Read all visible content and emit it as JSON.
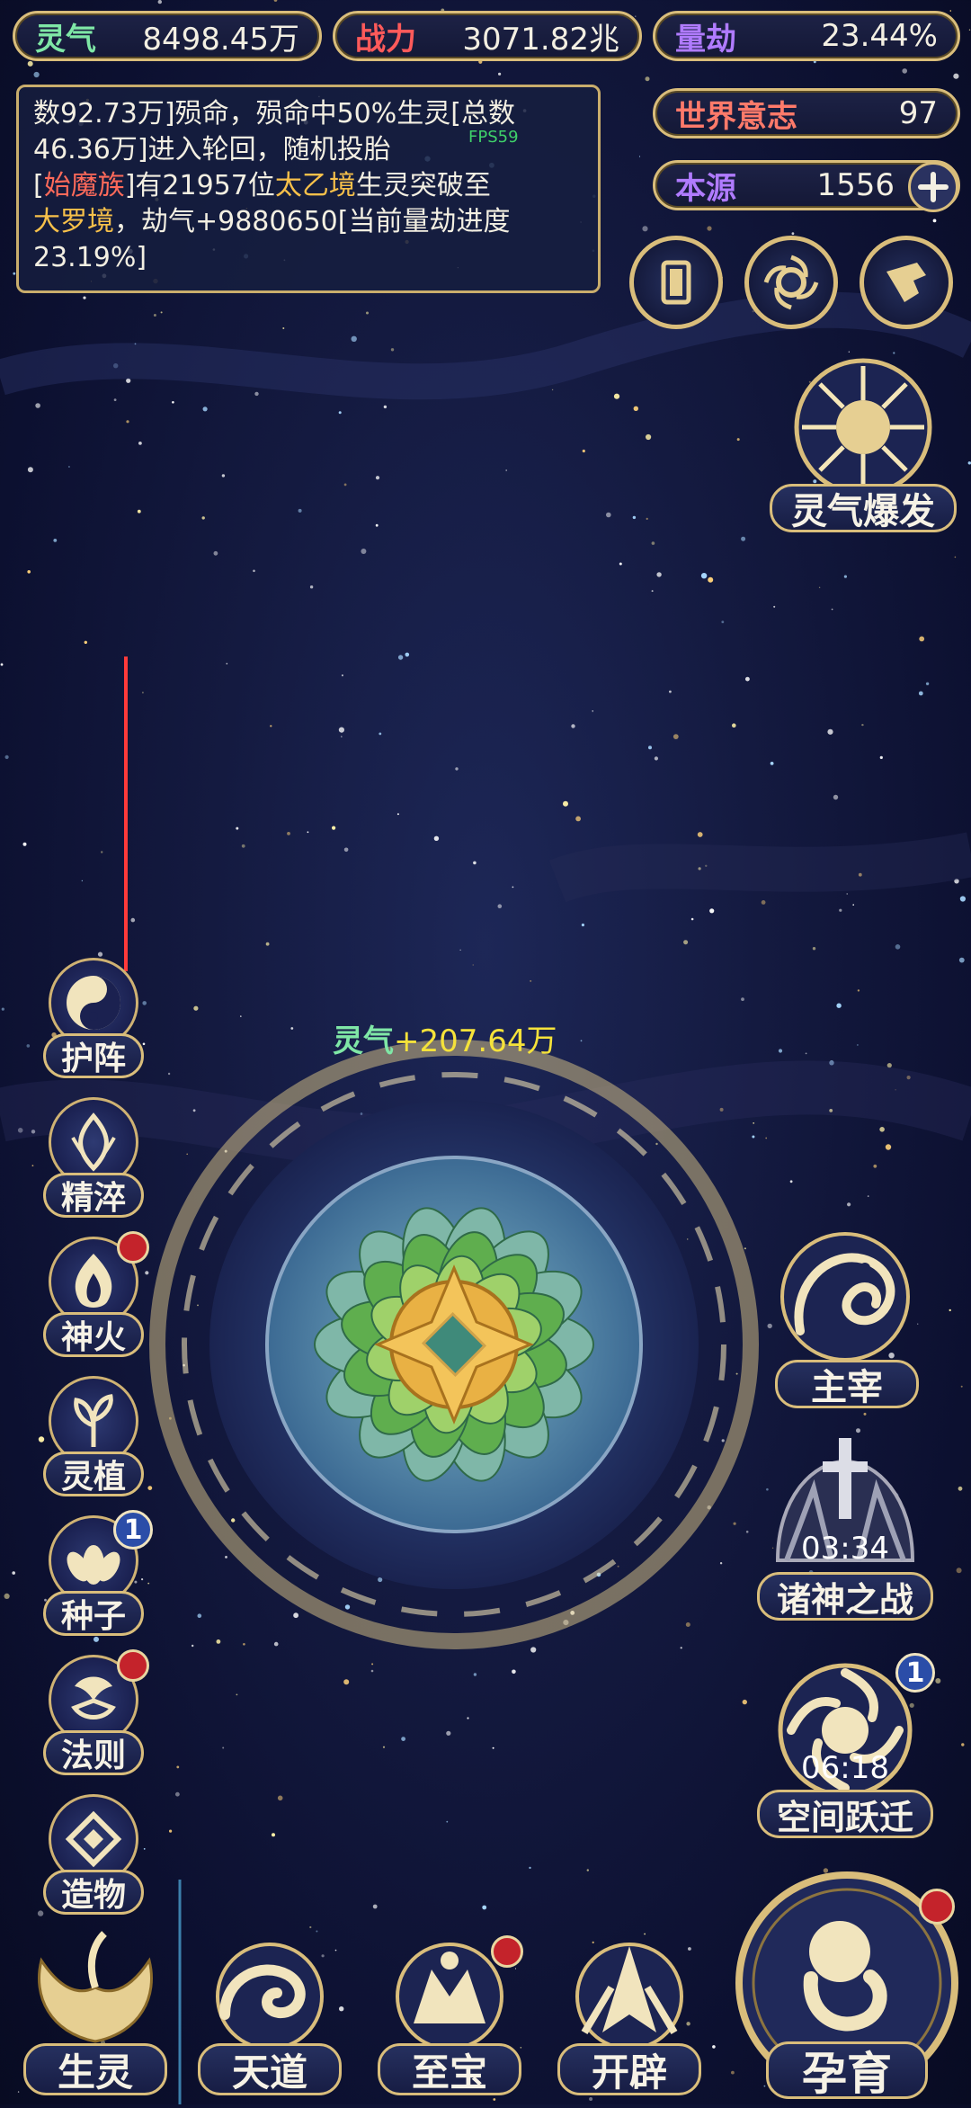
{
  "stats": {
    "lingqi": {
      "label": "灵气",
      "value": "8498.45万"
    },
    "zhanli": {
      "label": "战力",
      "value": "3071.82兆"
    },
    "liangjie": {
      "label": "量劫",
      "value": "23.44%"
    },
    "shijie": {
      "label": "世界意志",
      "value": "97"
    },
    "benyuan": {
      "label": "本源",
      "value": "1556"
    }
  },
  "log": {
    "line1": "数92.73万]殒命，殒命中50%生灵[总数",
    "line2": "46.36万]进入轮回，随机投胎",
    "fps": "FPS59",
    "line3_a": "[",
    "line3_race": "始魔族",
    "line3_b": "]有21957位",
    "line3_realm1": "太乙境",
    "line3_c": "生灵突破至",
    "line4_realm2": "大罗境",
    "line4_b": "，劫气+9880650[当前量劫进度",
    "line5": "23.19%]"
  },
  "burst": {
    "label": "灵气爆发"
  },
  "gain": {
    "label": "灵气",
    "value": "+207.64万"
  },
  "left_menu": [
    {
      "label": "护阵"
    },
    {
      "label": "精淬"
    },
    {
      "label": "神火"
    },
    {
      "label": "灵植"
    },
    {
      "label": "种子",
      "badge": "1"
    },
    {
      "label": "法则"
    },
    {
      "label": "造物"
    }
  ],
  "right_menu": {
    "zhuzai": {
      "label": "主宰"
    },
    "zhushen": {
      "label": "诸神之战",
      "timer": "03:34"
    },
    "kongjian": {
      "label": "空间跃迁",
      "timer": "06:18",
      "badge": "1"
    }
  },
  "bottom_menu": [
    {
      "label": "生灵"
    },
    {
      "label": "天道"
    },
    {
      "label": "至宝"
    },
    {
      "label": "开辟"
    }
  ],
  "yunyu": {
    "label": "孕育"
  },
  "colors": {
    "gold": "#d9bd7b",
    "lingqi_green": "#7fe7a6",
    "zhanli_red": "#ff5a5a",
    "liangjie_purple": "#b07bff",
    "alert_red": "#c4232b"
  }
}
